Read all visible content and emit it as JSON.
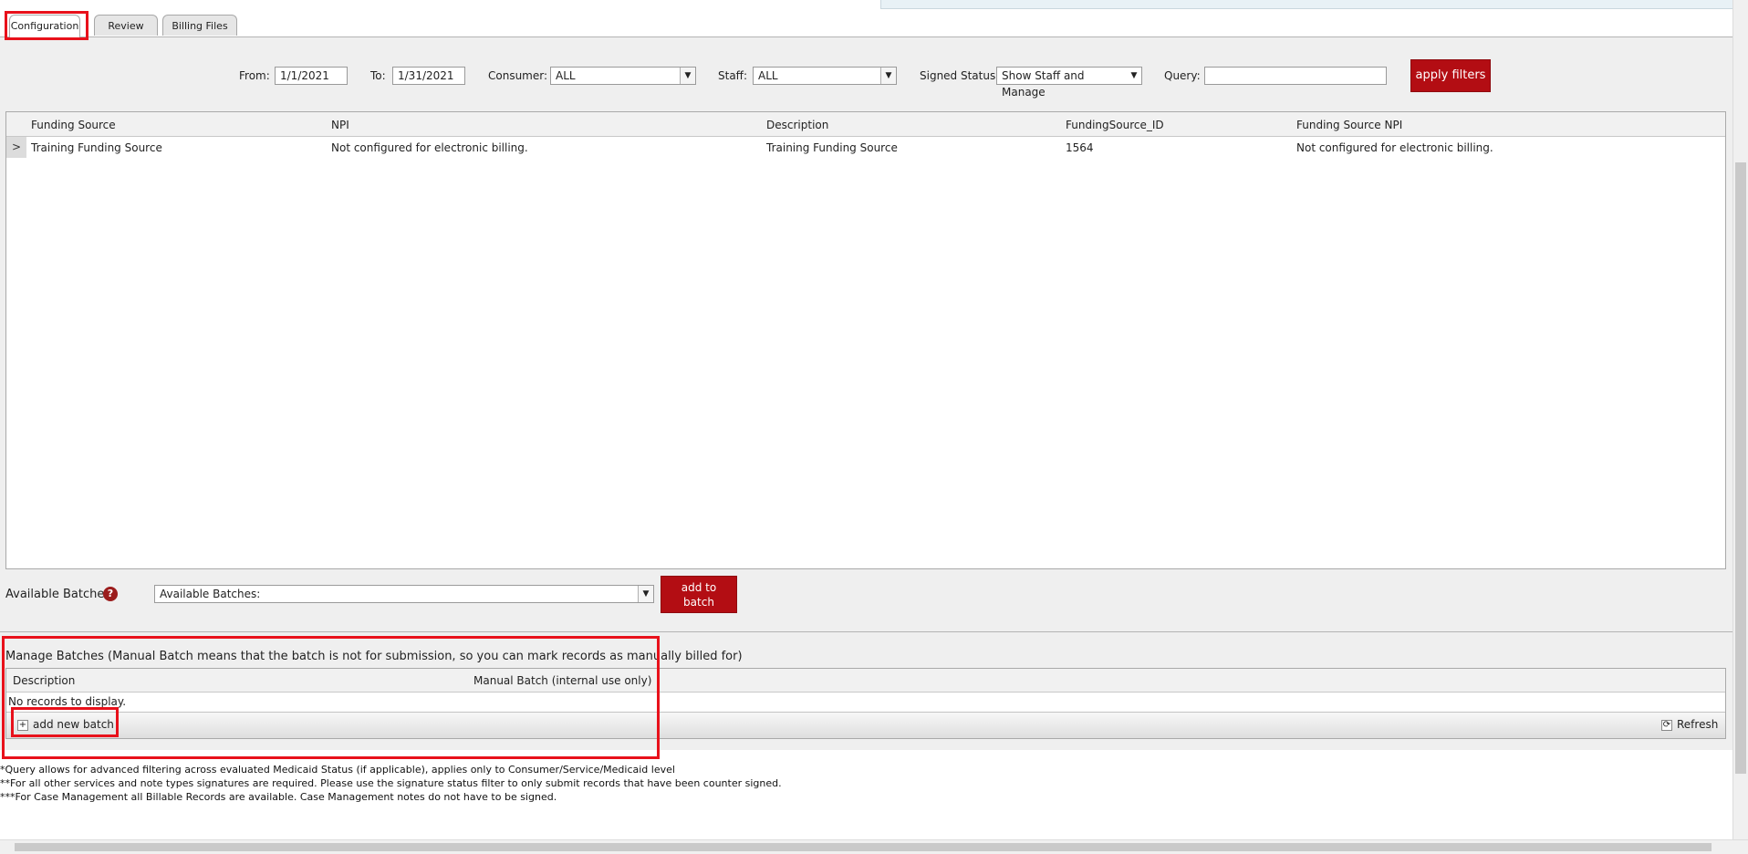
{
  "tabs": [
    {
      "label": "Configuration"
    },
    {
      "label": "Review"
    },
    {
      "label": "Billing Files"
    }
  ],
  "filters": {
    "from_label": "From:",
    "from_value": "1/1/2021",
    "to_label": "To:",
    "to_value": "1/31/2021",
    "consumer_label": "Consumer:",
    "consumer_value": "ALL",
    "staff_label": "Staff:",
    "staff_value": "ALL",
    "signed_label": "Signed Status:",
    "signed_value": "Show Staff and Manage",
    "query_label": "Query:",
    "query_value": "",
    "apply_label": "apply filters"
  },
  "grid": {
    "headers": [
      "Funding Source",
      "NPI",
      "Description",
      "FundingSource_ID",
      "Funding Source NPI"
    ],
    "rows": [
      [
        "Training Funding Source",
        "Not configured for electronic billing.",
        "Training Funding Source",
        "1564",
        "Not configured for electronic billing."
      ]
    ]
  },
  "batches": {
    "label": "Available Batches:",
    "help": "?",
    "select_value": "Available Batches:",
    "add_label_1": "add to",
    "add_label_2": "batch"
  },
  "manage": {
    "title": "Manage Batches (Manual Batch means that the batch is not for submission, so you can mark records as manually billed for)",
    "headers": [
      "Description",
      "Manual Batch (internal use only)"
    ],
    "empty": "No records to display.",
    "add_label": "add new batch",
    "refresh_label": "Refresh"
  },
  "footnotes": [
    "*Query allows for advanced filtering across evaluated Medicaid Status (if applicable), applies only to Consumer/Service/Medicaid level",
    "**For all other services and note types signatures are required. Please use the signature status filter to only submit records that have been counter signed.",
    "***For Case Management all Billable Records are available. Case Management notes do not have to be signed."
  ],
  "colors": {
    "accent": "#b30d13",
    "highlight": "#e8111b"
  }
}
